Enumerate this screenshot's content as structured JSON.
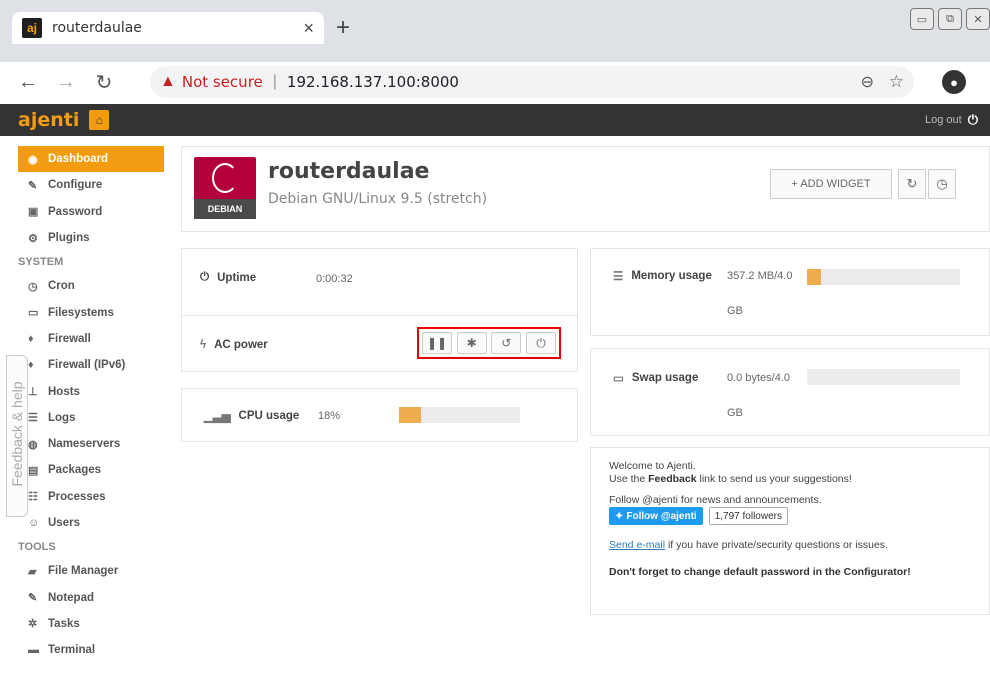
{
  "browser": {
    "tab_title": "routerdaulae",
    "favicon_text": "aj",
    "security_label": "Not secure",
    "url": "192.168.137.100:8000"
  },
  "topbar": {
    "brand": "ajenti",
    "logout_label": "Log out"
  },
  "sidebar": {
    "items": [
      {
        "label": "Dashboard",
        "icon": "dashboard-icon",
        "active": true
      },
      {
        "label": "Configure",
        "icon": "wrench-icon"
      },
      {
        "label": "Password",
        "icon": "lock-icon"
      },
      {
        "label": "Plugins",
        "icon": "gears-icon"
      }
    ],
    "system_label": "SYSTEM",
    "system_items": [
      {
        "label": "Cron",
        "icon": "clock-icon"
      },
      {
        "label": "Filesystems",
        "icon": "hdd-icon"
      },
      {
        "label": "Firewall",
        "icon": "fire-icon"
      },
      {
        "label": "Firewall (IPv6)",
        "icon": "fire-icon"
      },
      {
        "label": "Hosts",
        "icon": "sitemap-icon"
      },
      {
        "label": "Logs",
        "icon": "list-icon"
      },
      {
        "label": "Nameservers",
        "icon": "globe-icon"
      },
      {
        "label": "Packages",
        "icon": "gift-icon"
      },
      {
        "label": "Processes",
        "icon": "tasks-icon"
      },
      {
        "label": "Users",
        "icon": "users-icon"
      }
    ],
    "tools_label": "TOOLS",
    "tools_items": [
      {
        "label": "File Manager",
        "icon": "folder-icon"
      },
      {
        "label": "Notepad",
        "icon": "edit-icon"
      },
      {
        "label": "Tasks",
        "icon": "cog-icon"
      },
      {
        "label": "Terminal",
        "icon": "terminal-icon"
      }
    ],
    "feedback_label": "Feedback & help"
  },
  "header": {
    "hostname": "routerdaulae",
    "os": "Debian GNU/Linux 9.5 (stretch)",
    "logo_label": "DEBIAN",
    "add_widget_label": "+ ADD WIDGET"
  },
  "widgets": {
    "uptime": {
      "label": "Uptime",
      "value": "0:00:32"
    },
    "ac_power": {
      "label": "AC power"
    },
    "cpu": {
      "label": "CPU usage",
      "value": "18%",
      "fraction": 0.18
    },
    "memory": {
      "label": "Memory usage",
      "value_line1": "357.2 MB/4.0",
      "value_line2": "GB",
      "fraction": 0.09
    },
    "swap": {
      "label": "Swap usage",
      "value_line1": "0.0 bytes/4.0",
      "value_line2": "GB",
      "fraction": 0.0
    }
  },
  "welcome": {
    "line1": "Welcome to Ajenti.",
    "line2_pre": "Use the ",
    "line2_bold": "Feedback",
    "line2_post": " link to send us your suggestions!",
    "follow_text": "Follow @ajenti for news and announcements.",
    "twitter_btn": "Follow @ajenti",
    "followers": "1,797 followers",
    "email_link": "Send e-mail",
    "email_post": " if you have private/security questions or issues.",
    "warning": "Don't forget to change default password in the Configurator!"
  },
  "colors": {
    "accent": "#f39c12",
    "topbar": "#333333",
    "highlight_border": "#ee0000"
  }
}
